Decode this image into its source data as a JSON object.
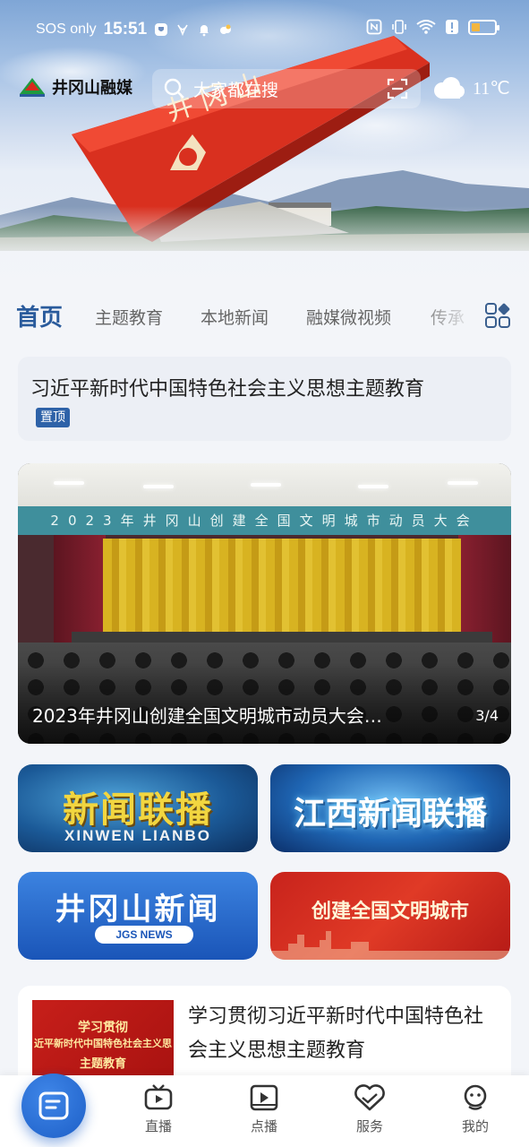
{
  "status_bar": {
    "carrier": "SOS only",
    "time": "15:51"
  },
  "header": {
    "logo_text": "井冈山融媒",
    "search_placeholder": "大家都在搜",
    "weather": "11℃"
  },
  "tabs": [
    {
      "label": "首页",
      "active": true
    },
    {
      "label": "主题教育",
      "active": false
    },
    {
      "label": "本地新闻",
      "active": false
    },
    {
      "label": "融媒微视频",
      "active": false
    },
    {
      "label": "传承",
      "active": false
    }
  ],
  "pinned": {
    "title": "习近平新时代中国特色社会主义思想主题教育",
    "badge": "置顶"
  },
  "banner": {
    "sign_text": "2023年井冈山创建全国文明城市动员大会",
    "caption": "2023年井冈山创建全国文明城市动员大会…",
    "pager": "3/4"
  },
  "tiles": {
    "xwlb_title": "新闻联播",
    "xwlb_sub": "XINWEN LIANBO",
    "jxxw_title": "江西新闻联播",
    "jgs_title": "井冈山新闻",
    "jgs_sub": "JGS NEWS",
    "wm_title": "创建全国文明城市"
  },
  "article": {
    "thumb_line1": "学习贯彻",
    "thumb_line2": "近平新时代中国特色社会主义思",
    "thumb_line3": "主题教育",
    "title": "学习贯彻习近平新时代中国特色社会主义思想主题教育"
  },
  "bottom_nav": [
    {
      "label": "直播",
      "icon": "tv-icon"
    },
    {
      "label": "点播",
      "icon": "video-play-icon"
    },
    {
      "label": "服务",
      "icon": "handshake-heart-icon"
    },
    {
      "label": "我的",
      "icon": "user-face-icon"
    }
  ],
  "colors": {
    "accent": "#2a5b9c",
    "fab": "#1d5fc7",
    "badge": "#2e62a8"
  }
}
